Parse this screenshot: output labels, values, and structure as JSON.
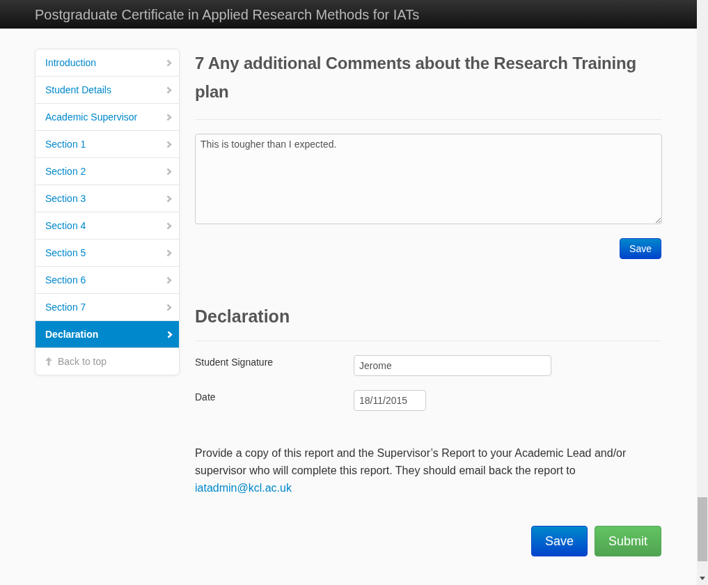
{
  "navbar": {
    "title": "Postgraduate Certificate in Applied Research Methods for IATs"
  },
  "sidebar": {
    "items": [
      {
        "kind": "link",
        "label": "Introduction",
        "selected": false
      },
      {
        "kind": "link",
        "label": "Student Details",
        "selected": false
      },
      {
        "kind": "link",
        "label": "Academic Supervisor",
        "selected": false
      },
      {
        "kind": "link",
        "label": "Section 1",
        "selected": false
      },
      {
        "kind": "link",
        "label": "Section 2",
        "selected": false
      },
      {
        "kind": "link",
        "label": "Section 3",
        "selected": false
      },
      {
        "kind": "link",
        "label": "Section 4",
        "selected": false
      },
      {
        "kind": "link",
        "label": "Section 5",
        "selected": false
      },
      {
        "kind": "link",
        "label": "Section 6",
        "selected": false
      },
      {
        "kind": "link",
        "label": "Section 7",
        "selected": false
      },
      {
        "kind": "link",
        "label": "Declaration",
        "selected": true
      },
      {
        "kind": "back",
        "label": "Back to top",
        "selected": false
      }
    ]
  },
  "comments": {
    "heading": "7 Any additional Comments about the Research Training plan",
    "value": "This is tougher than I expected.",
    "save_button": "Save"
  },
  "declaration": {
    "heading": "Declaration",
    "fields": [
      {
        "label": "Student Signature",
        "value": "Jerome",
        "kind": "text"
      },
      {
        "label": "Date",
        "value": "18/11/2015",
        "kind": "date"
      }
    ],
    "note": "Provide a copy of this report and the Supervisor’s Report to your Academic Lead and/or supervisor who will complete this report. They should email back the report to",
    "email": "iatadmin@kcl.ac.uk",
    "buttons": [
      {
        "label": "Save",
        "kind": "primary"
      },
      {
        "label": "Submit",
        "kind": "success"
      }
    ]
  }
}
